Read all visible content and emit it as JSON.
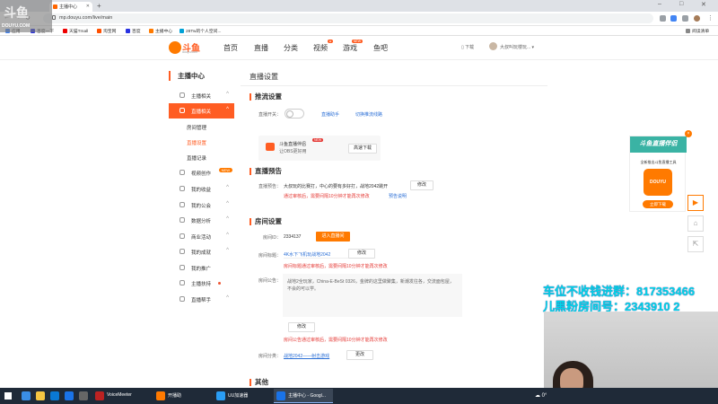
{
  "browser": {
    "tab_title": "主播中心",
    "url": "mp.douyu.com/live/main",
    "bookmarks": [
      "应用",
      "百度一下",
      "天猫Tmall",
      "淘宝网",
      "百度",
      "主播中心",
      "28Tw的个人空间..."
    ],
    "bookmarks_right": "阅读清单"
  },
  "watermark": {
    "title": "斗鱼",
    "sub": "DOUYU.COM"
  },
  "site": {
    "logo_text": "斗鱼",
    "logo_sub": "douyu.com",
    "nav": [
      {
        "label": "首页"
      },
      {
        "label": "直播"
      },
      {
        "label": "分类"
      },
      {
        "label": "视频",
        "badge": "●"
      },
      {
        "label": "游戏",
        "badge": "NEW"
      },
      {
        "label": "鱼吧"
      }
    ],
    "download": "下载",
    "username": "大叔叫玩楼玩..."
  },
  "sidebar": {
    "title": "主播中心",
    "items": [
      {
        "label": "主播相关",
        "chev": "^"
      },
      {
        "label": "直播相关",
        "chev": "^",
        "active": true
      },
      {
        "label": "房间管理",
        "sub": true
      },
      {
        "label": "直播设置",
        "sub": true,
        "current": true
      },
      {
        "label": "直播记录",
        "sub": true
      },
      {
        "label": "视频创作",
        "tag": "NEW"
      },
      {
        "label": "我的收益",
        "chev": "^"
      },
      {
        "label": "我的公会",
        "chev": "^"
      },
      {
        "label": "数据分析",
        "chev": "^"
      },
      {
        "label": "商业活动",
        "chev": "^"
      },
      {
        "label": "我的成就",
        "chev": "^"
      },
      {
        "label": "我的推广"
      },
      {
        "label": "主播扶持",
        "dot": true
      },
      {
        "label": "直播帮手",
        "chev": "^"
      }
    ]
  },
  "main": {
    "title": "直播设置",
    "push": {
      "title": "推流设置",
      "switch_label": "直播开关：",
      "link1": "直播助手",
      "link2": "切换推流线路",
      "promo_title": "斗鱼直播伴侣",
      "promo_sub": "让OBS更好用",
      "promo_new": "NEW",
      "promo_btn": "高速下载"
    },
    "notice": {
      "title": "直播预告",
      "label": "直播预告：",
      "text": "大叔玩的比赛打，中心的要有多好打，战地2042跳开",
      "edit_btn": "修改",
      "warn": "通过审核后，需要间隔10分钟才能再次修改",
      "link": "预告说明"
    },
    "room": {
      "title": "房间设置",
      "id_label": "房间ID：",
      "id_value": "2334137",
      "enter_btn": "进入直播间",
      "name_label": "房间标题：",
      "name_value": "4K水下飞机玩战地2042",
      "name_btn": "修改",
      "name_warn": "房间标题通过审核后，需要间隔10分钟才能再次修改",
      "board_label": "房间公告：",
      "board_value": "战地2全玩家，China-E-BeSt 0326，金牌的这里做聚集，新潮发往各，交流面包屋，不会的可以学。",
      "board_btn": "修改",
      "board_warn": "房间公告通过审核后，需要间隔10分钟才能再次修改",
      "cat_label": "房间分类：",
      "cat_value": "战地2042——射击游戏",
      "cat_btn": "更改"
    },
    "other": {
      "title": "其他"
    }
  },
  "floatcard": {
    "title": "斗鱼直播伴侣",
    "sub": "全新推出斗鱼直播工具",
    "img": "DOUYU",
    "btn": "立即下载",
    "close": "×"
  },
  "overlay": {
    "line1": "车位不收钱进群：817353466",
    "line2": "儿黑粉房间号：2343910 2"
  },
  "taskbar": {
    "apps": [
      "VoiceMeeter",
      "开播助",
      "UU加速器",
      "主播中心 - Googl..."
    ],
    "tray": "0°"
  }
}
